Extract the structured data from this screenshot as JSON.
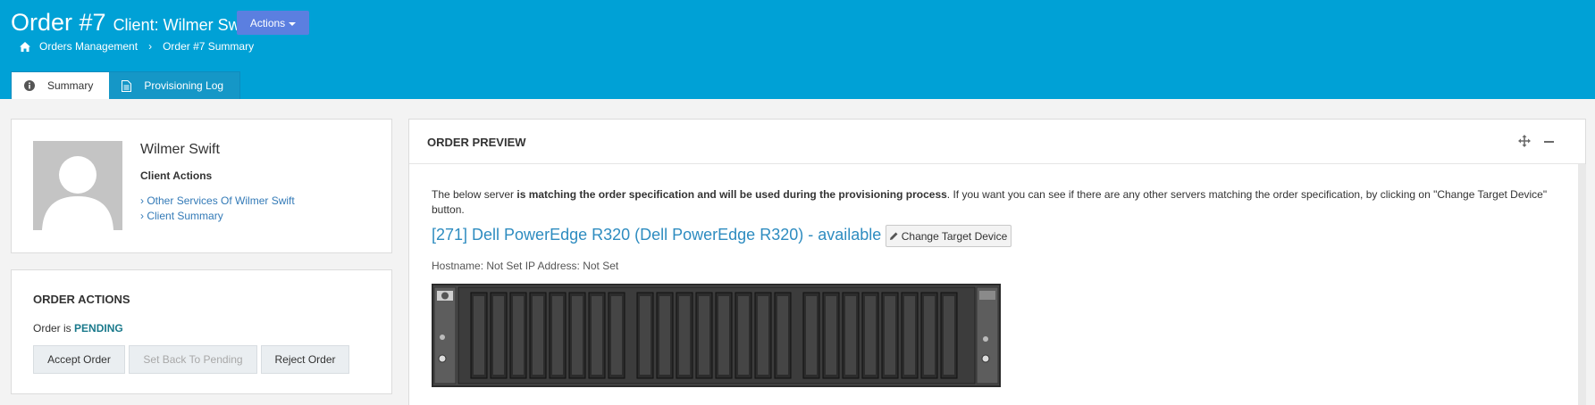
{
  "header": {
    "order_title": "Order #7",
    "client_title": "Client: Wilmer Swift",
    "actions_label": "Actions",
    "breadcrumb": {
      "home": "Orders Management",
      "current": "Order #7 Summary"
    },
    "tabs": [
      {
        "label": "Summary",
        "icon": "info-icon"
      },
      {
        "label": "Provisioning Log",
        "icon": "document-icon"
      }
    ]
  },
  "client_panel": {
    "name": "Wilmer Swift",
    "actions_label": "Client Actions",
    "links": [
      "Other Services Of Wilmer Swift",
      "Client Summary"
    ]
  },
  "order_actions": {
    "heading": "ORDER ACTIONS",
    "status_prefix": "Order is",
    "status_value": "PENDING",
    "buttons": {
      "accept": "Accept Order",
      "set_pending": "Set Back To Pending",
      "reject": "Reject Order"
    }
  },
  "order_preview": {
    "heading": "ORDER PREVIEW",
    "desc_before": "The below server ",
    "desc_bold": "is matching the order specification and will be used during the provisioning process",
    "desc_after": ". If you want you can see if there are any other servers matching the order specification, by clicking on \"Change Target Device\" button.",
    "device_title": "[271] Dell PowerEdge R320 (Dell PowerEdge R320) - available",
    "change_target_label": "Change Target Device",
    "host_info": "Hostname: Not Set IP Address: Not Set"
  },
  "colors": {
    "header_bg": "#00a1d6",
    "accent": "#5b7fe0",
    "link": "#337ab7",
    "status": "#1b7a8c"
  }
}
